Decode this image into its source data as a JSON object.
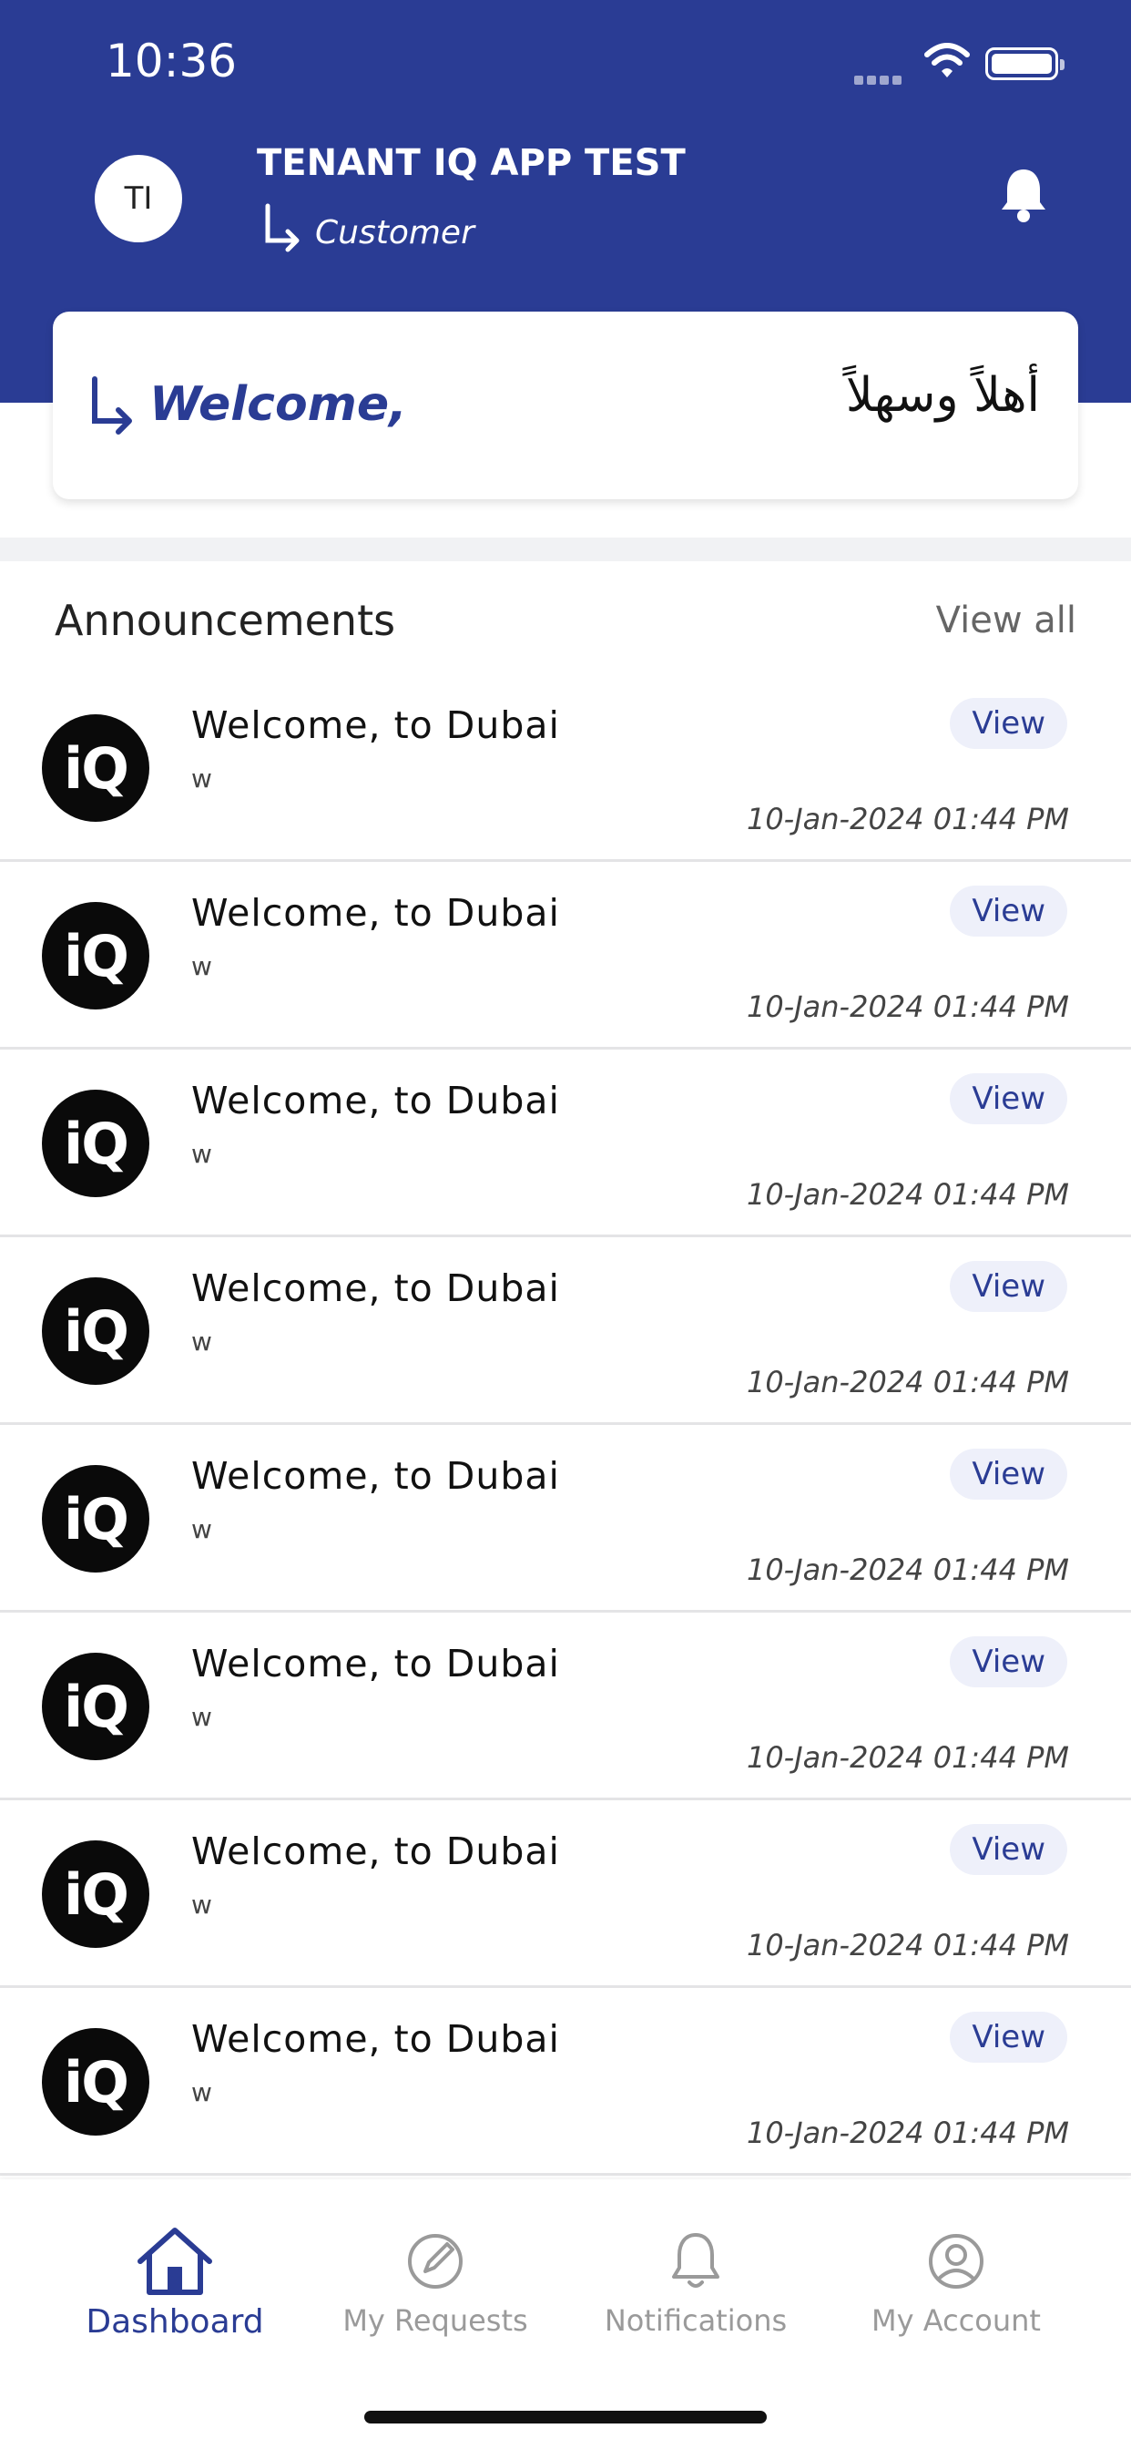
{
  "status_bar": {
    "time": "10:36"
  },
  "header": {
    "avatar_initials": "TI",
    "app_title": "TENANT IQ APP TEST",
    "role": "Customer"
  },
  "welcome_card": {
    "welcome_text": "Welcome,",
    "arabic_text": "أهلاً وسهلاً"
  },
  "announcements": {
    "title": "Announcements",
    "view_all_label": "View all",
    "items": [
      {
        "logo": "iQ",
        "title": "Welcome, to Dubai",
        "subtitle": "w",
        "button": "View",
        "date": "10-Jan-2024 01:44 PM"
      },
      {
        "logo": "iQ",
        "title": "Welcome, to Dubai",
        "subtitle": "w",
        "button": "View",
        "date": "10-Jan-2024 01:44 PM"
      },
      {
        "logo": "iQ",
        "title": "Welcome, to Dubai",
        "subtitle": "w",
        "button": "View",
        "date": "10-Jan-2024 01:44 PM"
      },
      {
        "logo": "iQ",
        "title": "Welcome, to Dubai",
        "subtitle": "w",
        "button": "View",
        "date": "10-Jan-2024 01:44 PM"
      },
      {
        "logo": "iQ",
        "title": "Welcome, to Dubai",
        "subtitle": "w",
        "button": "View",
        "date": "10-Jan-2024 01:44 PM"
      },
      {
        "logo": "iQ",
        "title": "Welcome, to Dubai",
        "subtitle": "w",
        "button": "View",
        "date": "10-Jan-2024 01:44 PM"
      },
      {
        "logo": "iQ",
        "title": "Welcome, to Dubai",
        "subtitle": "w",
        "button": "View",
        "date": "10-Jan-2024 01:44 PM"
      },
      {
        "logo": "iQ",
        "title": "Welcome, to Dubai",
        "subtitle": "w",
        "button": "View",
        "date": "10-Jan-2024 01:44 PM"
      }
    ]
  },
  "tabbar": {
    "tabs": [
      {
        "label": "Dashboard",
        "icon": "home-icon",
        "active": true
      },
      {
        "label": "My Requests",
        "icon": "edit-request-icon",
        "active": false
      },
      {
        "label": "Notifications",
        "icon": "bell-icon",
        "active": false
      },
      {
        "label": "My Account",
        "icon": "user-circle-icon",
        "active": false
      }
    ]
  },
  "colors": {
    "primary": "#2a3c94",
    "accent_bg": "#eef0fa"
  }
}
